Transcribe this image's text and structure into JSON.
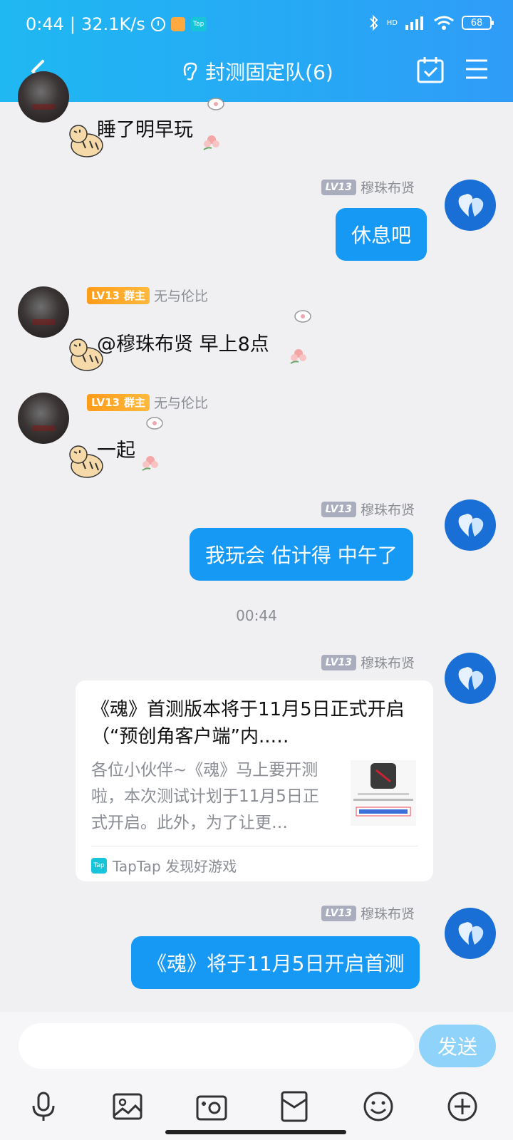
{
  "status_bar": {
    "time": "0:44",
    "separator": "|",
    "network_speed": "32.1K/s",
    "tap_label": "Tap",
    "signal_label": "HD",
    "battery": "68"
  },
  "header": {
    "title": "封测固定队(6)"
  },
  "messages": [
    {
      "side": "left",
      "text": "睡了明早玩"
    },
    {
      "side": "right",
      "level": "LV13",
      "name": "穆珠布贤",
      "text": "休息吧"
    },
    {
      "side": "left",
      "level": "LV13",
      "role": "群主",
      "name": "无与伦比",
      "text": "@穆珠布贤 早上8点"
    },
    {
      "side": "left",
      "level": "LV13",
      "role": "群主",
      "name": "无与伦比",
      "text": "一起"
    },
    {
      "side": "right",
      "level": "LV13",
      "name": "穆珠布贤",
      "text": "我玩会 估计得 中午了"
    },
    {
      "type": "time",
      "text": "00:44"
    },
    {
      "side": "right",
      "level": "LV13",
      "name": "穆珠布贤",
      "type": "card",
      "card": {
        "title": "《魂》首测版本将于11月5日正式开启（“预创角客户端”内..…",
        "desc": "各位小伙伴~《魂》马上要开测啦，本次测试计划于11月5日正式开启。此外，为了让更…",
        "source_logo": "Tap",
        "source": "TapTap 发现好游戏"
      }
    },
    {
      "side": "right",
      "level": "LV13",
      "name": "穆珠布贤",
      "text": "《魂》将于11月5日开启首测"
    }
  ],
  "input": {
    "placeholder": "",
    "send_label": "发送"
  },
  "toolbar": [
    "mic-icon",
    "image-icon",
    "camera-icon",
    "red-packet-icon",
    "emoji-icon",
    "plus-icon"
  ],
  "colors": {
    "header": "#1fb8f2",
    "bubble": "#1599f5",
    "send_disabled": "#8fd3fb",
    "owner_badge": "#ff9c1a"
  }
}
